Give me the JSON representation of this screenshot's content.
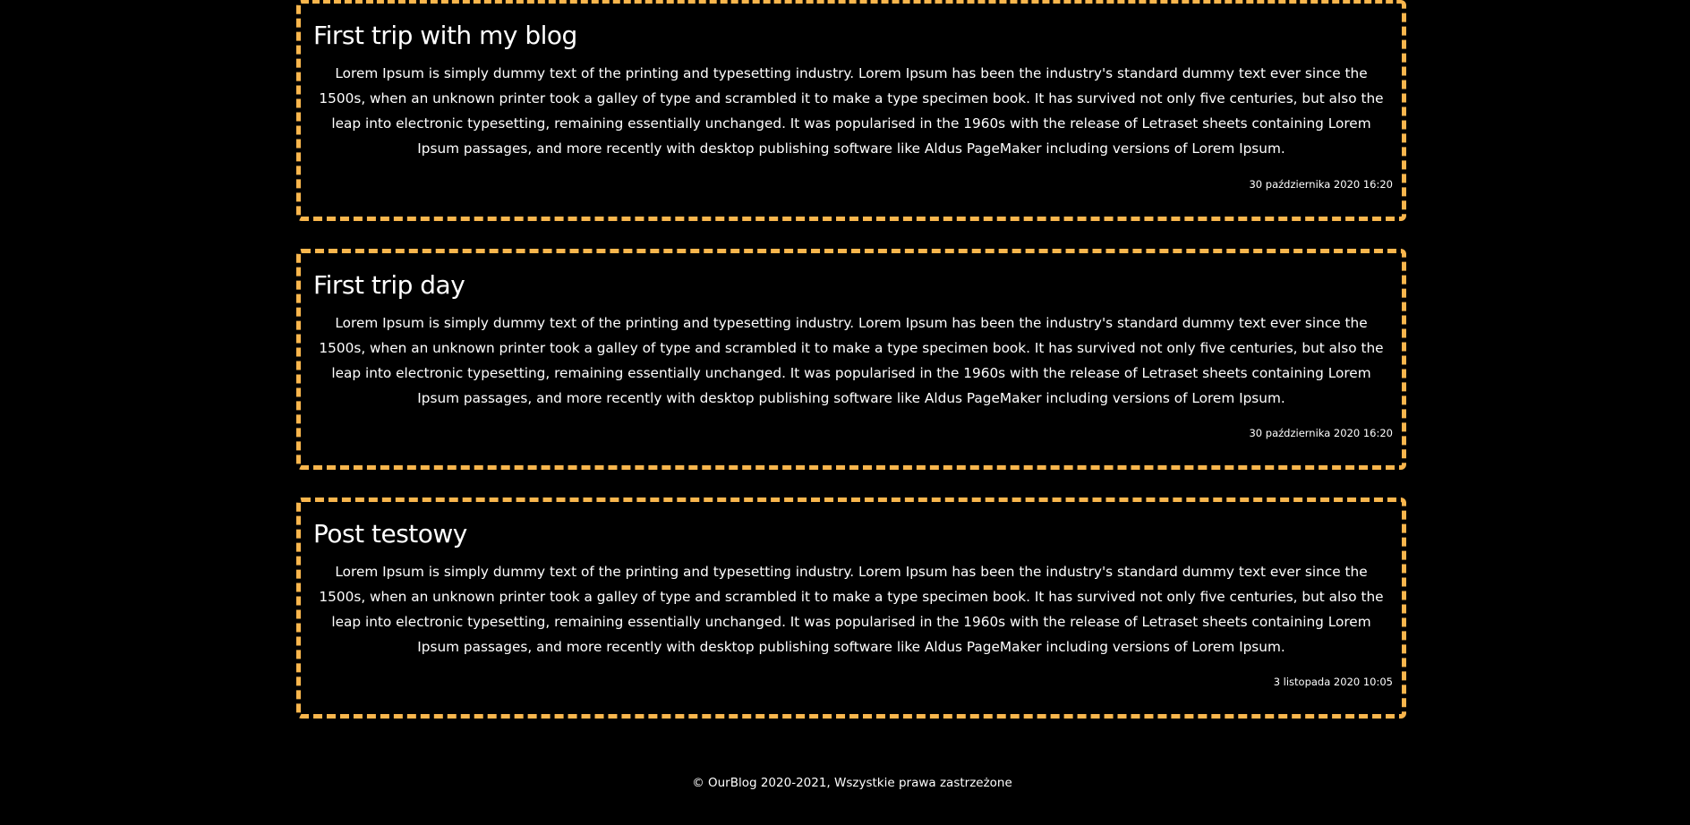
{
  "colors": {
    "background": "#000000",
    "accent_border": "#f9b64d",
    "text": "#ffffff"
  },
  "posts": [
    {
      "title": "First trip with my blog",
      "body": "Lorem Ipsum is simply dummy text of the printing and typesetting industry. Lorem Ipsum has been the industry's standard dummy text ever since the 1500s, when an unknown printer took a galley of type and scrambled it to make a type specimen book. It has survived not only five centuries, but also the leap into electronic typesetting, remaining essentially unchanged. It was popularised in the 1960s with the release of Letraset sheets containing Lorem Ipsum passages, and more recently with desktop publishing software like Aldus PageMaker including versions of Lorem Ipsum.",
      "date": "30 października 2020 16:20"
    },
    {
      "title": "First trip day",
      "body": "Lorem Ipsum is simply dummy text of the printing and typesetting industry. Lorem Ipsum has been the industry's standard dummy text ever since the 1500s, when an unknown printer took a galley of type and scrambled it to make a type specimen book. It has survived not only five centuries, but also the leap into electronic typesetting, remaining essentially unchanged. It was popularised in the 1960s with the release of Letraset sheets containing Lorem Ipsum passages, and more recently with desktop publishing software like Aldus PageMaker including versions of Lorem Ipsum.",
      "date": "30 października 2020 16:20"
    },
    {
      "title": "Post testowy",
      "body": "Lorem Ipsum is simply dummy text of the printing and typesetting industry. Lorem Ipsum has been the industry's standard dummy text ever since the 1500s, when an unknown printer took a galley of type and scrambled it to make a type specimen book. It has survived not only five centuries, but also the leap into electronic typesetting, remaining essentially unchanged. It was popularised in the 1960s with the release of Letraset sheets containing Lorem Ipsum passages, and more recently with desktop publishing software like Aldus PageMaker including versions of Lorem Ipsum.",
      "date": "3 listopada 2020 10:05"
    }
  ],
  "footer": {
    "copyright": "© OurBlog 2020-2021, Wszystkie prawa zastrzeżone"
  }
}
